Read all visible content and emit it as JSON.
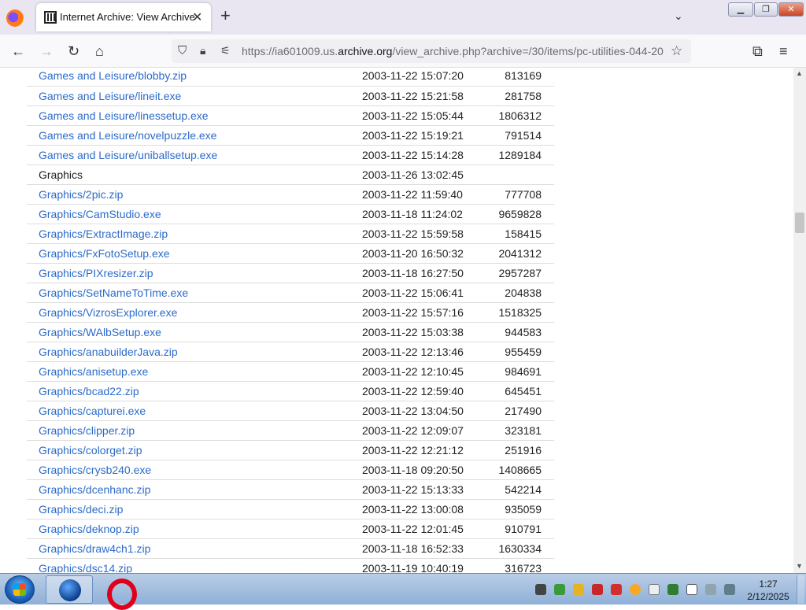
{
  "browser": {
    "tab_title": "Internet Archive: View Archive",
    "url_prefix": "https://ia601009.us.",
    "url_domain": "archive.org",
    "url_suffix": "/view_archive.php?archive=/30/items/pc-utilities-044-20"
  },
  "files": [
    {
      "name": "Games and Leisure/blobby.zip",
      "date": "2003-11-22 15:07:20",
      "size": "813169",
      "link": true
    },
    {
      "name": "Games and Leisure/lineit.exe",
      "date": "2003-11-22 15:21:58",
      "size": "281758",
      "link": true
    },
    {
      "name": "Games and Leisure/linessetup.exe",
      "date": "2003-11-22 15:05:44",
      "size": "1806312",
      "link": true
    },
    {
      "name": "Games and Leisure/novelpuzzle.exe",
      "date": "2003-11-22 15:19:21",
      "size": "791514",
      "link": true
    },
    {
      "name": "Games and Leisure/uniballsetup.exe",
      "date": "2003-11-22 15:14:28",
      "size": "1289184",
      "link": true
    },
    {
      "name": "Graphics",
      "date": "2003-11-26 13:02:45",
      "size": "",
      "link": false
    },
    {
      "name": "Graphics/2pic.zip",
      "date": "2003-11-22 11:59:40",
      "size": "777708",
      "link": true
    },
    {
      "name": "Graphics/CamStudio.exe",
      "date": "2003-11-18 11:24:02",
      "size": "9659828",
      "link": true
    },
    {
      "name": "Graphics/ExtractImage.zip",
      "date": "2003-11-22 15:59:58",
      "size": "158415",
      "link": true
    },
    {
      "name": "Graphics/FxFotoSetup.exe",
      "date": "2003-11-20 16:50:32",
      "size": "2041312",
      "link": true
    },
    {
      "name": "Graphics/PIXresizer.zip",
      "date": "2003-11-18 16:27:50",
      "size": "2957287",
      "link": true
    },
    {
      "name": "Graphics/SetNameToTime.exe",
      "date": "2003-11-22 15:06:41",
      "size": "204838",
      "link": true
    },
    {
      "name": "Graphics/VizrosExplorer.exe",
      "date": "2003-11-22 15:57:16",
      "size": "1518325",
      "link": true
    },
    {
      "name": "Graphics/WAlbSetup.exe",
      "date": "2003-11-22 15:03:38",
      "size": "944583",
      "link": true
    },
    {
      "name": "Graphics/anabuilderJava.zip",
      "date": "2003-11-22 12:13:46",
      "size": "955459",
      "link": true
    },
    {
      "name": "Graphics/anisetup.exe",
      "date": "2003-11-22 12:10:45",
      "size": "984691",
      "link": true
    },
    {
      "name": "Graphics/bcad22.zip",
      "date": "2003-11-22 12:59:40",
      "size": "645451",
      "link": true
    },
    {
      "name": "Graphics/capturei.exe",
      "date": "2003-11-22 13:04:50",
      "size": "217490",
      "link": true
    },
    {
      "name": "Graphics/clipper.zip",
      "date": "2003-11-22 12:09:07",
      "size": "323181",
      "link": true
    },
    {
      "name": "Graphics/colorget.zip",
      "date": "2003-11-22 12:21:12",
      "size": "251916",
      "link": true
    },
    {
      "name": "Graphics/crysb240.exe",
      "date": "2003-11-18 09:20:50",
      "size": "1408665",
      "link": true
    },
    {
      "name": "Graphics/dcenhanc.zip",
      "date": "2003-11-22 15:13:33",
      "size": "542214",
      "link": true
    },
    {
      "name": "Graphics/deci.zip",
      "date": "2003-11-22 13:00:08",
      "size": "935059",
      "link": true
    },
    {
      "name": "Graphics/deknop.zip",
      "date": "2003-11-22 12:01:45",
      "size": "910791",
      "link": true
    },
    {
      "name": "Graphics/draw4ch1.zip",
      "date": "2003-11-18 16:52:33",
      "size": "1630334",
      "link": true
    },
    {
      "name": "Graphics/dsc14.zip",
      "date": "2003-11-19 10:40:19",
      "size": "316723",
      "link": true
    }
  ],
  "taskbar": {
    "time": "1:27",
    "date": "2/12/2025"
  },
  "colors": {
    "link": "#2c6bc9",
    "tab_bar": "#e9e6f2"
  }
}
